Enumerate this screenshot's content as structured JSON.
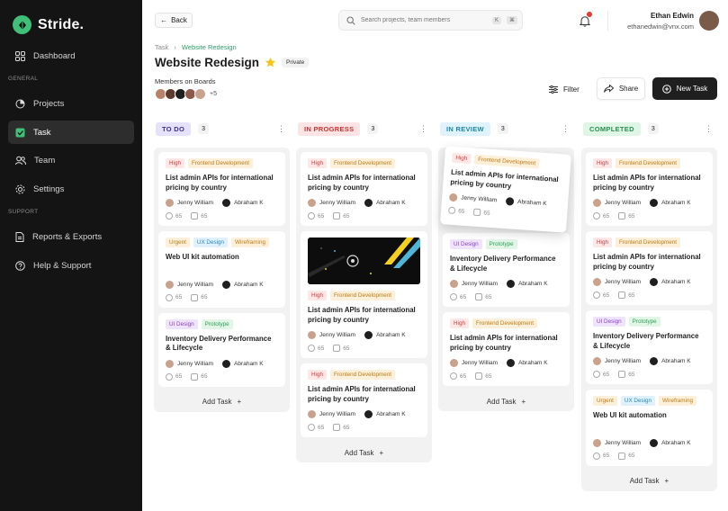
{
  "app": {
    "name": "Stride."
  },
  "sidebar": {
    "items": [
      {
        "label": "Dashboard"
      },
      {
        "label": "Projects"
      },
      {
        "label": "Task"
      },
      {
        "label": "Team"
      },
      {
        "label": "Settings"
      },
      {
        "label": "Reports & Exports"
      },
      {
        "label": "Help & Support"
      }
    ],
    "sections": {
      "general": "GENERAL",
      "support": "SUPPORT"
    }
  },
  "header": {
    "back_label": "Back",
    "search_placeholder": "Search projects, team members",
    "kbd1": "K",
    "kbd2": "⌘",
    "user_name": "Ethan Edwin",
    "user_email": "ethanedwin@vnx.com"
  },
  "breadcrumb": {
    "root": "Task",
    "current": "Website Redesign"
  },
  "page": {
    "title": "Website Redesign",
    "badge": "Private",
    "members_label": "Members on Boards",
    "members_more": "+5"
  },
  "actions": {
    "filter": "Filter",
    "share": "Share",
    "new_task": "New Task"
  },
  "colors": {
    "green": "#3fbf77",
    "dark": "#1f1f1f"
  },
  "columns": [
    {
      "label": "TO DO",
      "count": "3",
      "add": "Add Task"
    },
    {
      "label": "IN PROGRESS",
      "count": "3",
      "add": "Add Task"
    },
    {
      "label": "IN REVIEW",
      "count": "3",
      "add": "Add Task"
    },
    {
      "label": "COMPLETED",
      "count": "3",
      "add": "Add Task"
    }
  ],
  "tags": {
    "high": "High",
    "frontend": "Frontend Development",
    "urgent": "Urgent",
    "uxdesign": "UX Design",
    "wireframing": "Wireframing",
    "uidesign": "UI Design",
    "prototype": "Prototype"
  },
  "tasks": {
    "admin_api": "List admin APIs for international pricing by country",
    "webui": "Web UI kit automation",
    "inventory": "Inventory Delivery Performance & Lifecycle"
  },
  "people": {
    "jenny": "Jenny William",
    "abraham": "Abraham K"
  },
  "stats": {
    "comments": "65",
    "files": "65"
  }
}
